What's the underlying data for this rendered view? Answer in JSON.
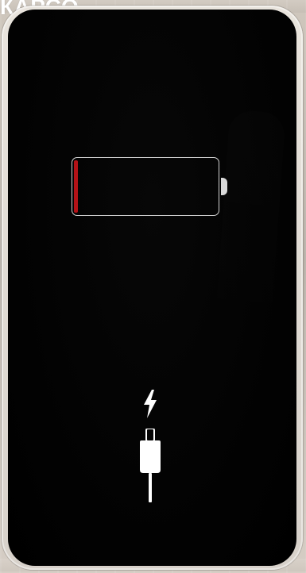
{
  "overlay": {
    "top_text": "КАРСО"
  },
  "status": {
    "battery_level_percent": 3
  },
  "icons": {
    "battery": "battery-icon",
    "charging": "lightning-bolt-icon",
    "cable": "charging-cable-icon"
  },
  "colors": {
    "battery_fill": "#b31217",
    "screen": "#000000",
    "outline": "#ffffff"
  }
}
